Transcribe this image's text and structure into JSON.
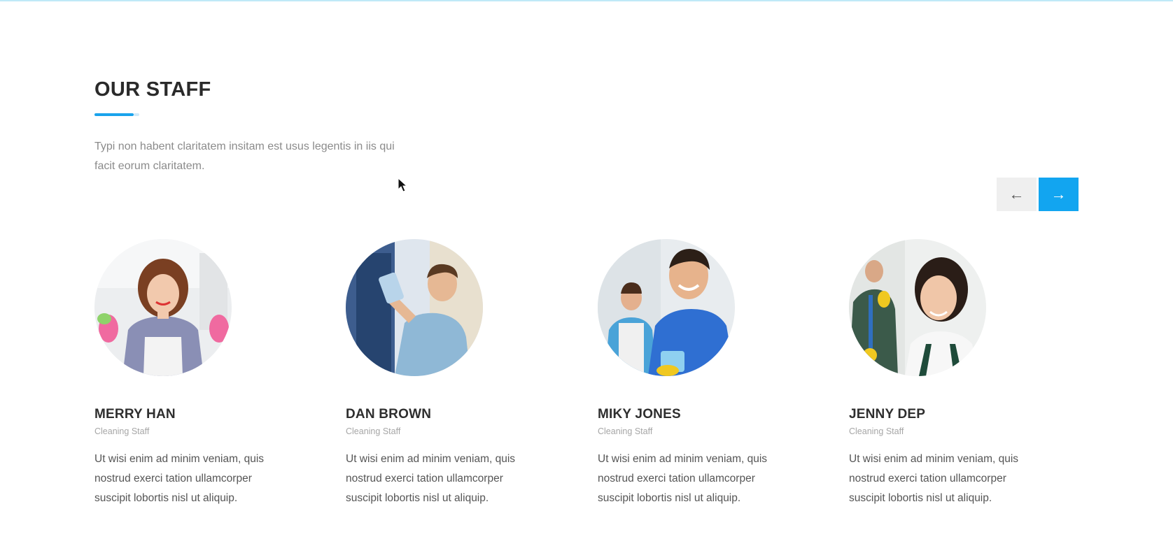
{
  "section": {
    "title": "OUR STAFF",
    "intro": "Typi non habent claritatem insitam est usus legentis in iis qui facit eorum claritatem.",
    "accent_color": "#12a5f0"
  },
  "nav": {
    "prev_icon": "arrow-left-icon",
    "prev_symbol": "←",
    "next_icon": "arrow-right-icon",
    "next_symbol": "→"
  },
  "staff": [
    {
      "name": "MERRY HAN",
      "role": "Cleaning Staff",
      "bio": "Ut wisi enim ad minim veniam, quis nostrud exerci tation ullamcorper suscipit lobortis nisl ut aliquip."
    },
    {
      "name": "DAN BROWN",
      "role": "Cleaning Staff",
      "bio": "Ut wisi enim ad minim veniam, quis nostrud exerci tation ullamcorper suscipit lobortis nisl ut aliquip."
    },
    {
      "name": "MIKY JONES",
      "role": "Cleaning Staff",
      "bio": "Ut wisi enim ad minim veniam, quis nostrud exerci tation ullamcorper suscipit lobortis nisl ut aliquip."
    },
    {
      "name": "JENNY DEP",
      "role": "Cleaning Staff",
      "bio": "Ut wisi enim ad minim veniam, quis nostrud exerci tation ullamcorper suscipit lobortis nisl ut aliquip."
    }
  ]
}
